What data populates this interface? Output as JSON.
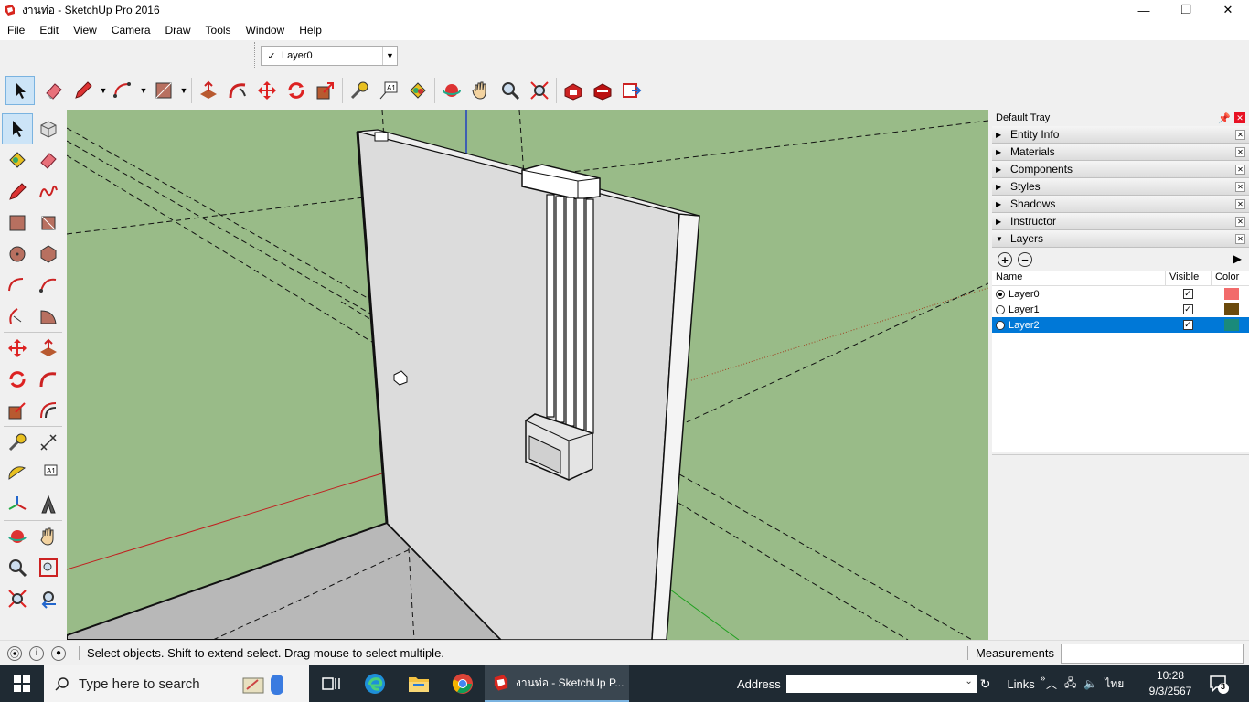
{
  "window": {
    "title": "งานท่อ - SketchUp Pro 2016",
    "minimize": "—",
    "restore": "❐",
    "close": "✕"
  },
  "menu": [
    "File",
    "Edit",
    "View",
    "Camera",
    "Draw",
    "Tools",
    "Window",
    "Help"
  ],
  "layer_dropdown": {
    "check": "✓",
    "value": "Layer0"
  },
  "tray": {
    "title": "Default Tray",
    "panels": [
      {
        "label": "Entity Info",
        "expanded": false
      },
      {
        "label": "Materials",
        "expanded": false
      },
      {
        "label": "Components",
        "expanded": false
      },
      {
        "label": "Styles",
        "expanded": false
      },
      {
        "label": "Shadows",
        "expanded": false
      },
      {
        "label": "Instructor",
        "expanded": false
      },
      {
        "label": "Layers",
        "expanded": true
      }
    ],
    "layers": {
      "columns": [
        "Name",
        "Visible",
        "Color"
      ],
      "rows": [
        {
          "name": "Layer0",
          "active": true,
          "visible": true,
          "color": "#f26b6b",
          "selected": false
        },
        {
          "name": "Layer1",
          "active": false,
          "visible": true,
          "color": "#6b4a0c",
          "selected": false
        },
        {
          "name": "Layer2",
          "active": false,
          "visible": true,
          "color": "#1a8a7a",
          "selected": true
        }
      ]
    }
  },
  "status": {
    "message": "Select objects. Shift to extend select. Drag mouse to select multiple.",
    "measurements_label": "Measurements",
    "measurements_value": ""
  },
  "taskbar": {
    "search_placeholder": "Type here to search",
    "active_app": "งานท่อ - SketchUp P...",
    "address_label": "Address",
    "links_label": "Links",
    "language": "ไทย",
    "time": "10:28",
    "date": "9/3/2567",
    "notifications": "3"
  },
  "colors": {
    "viewport_ground": "#99bb88",
    "selection": "#0078d7",
    "taskbar": "#1f2a33"
  }
}
